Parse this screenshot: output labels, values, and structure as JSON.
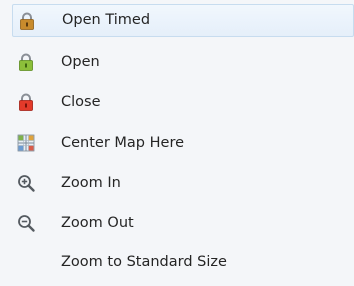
{
  "context_menu": {
    "items": [
      {
        "label": "Open Timed",
        "icon": "lock-timed-icon",
        "highlighted": true
      },
      {
        "label": "Open",
        "icon": "lock-open-green-icon"
      },
      {
        "label": "Close",
        "icon": "lock-closed-red-icon"
      },
      {
        "label": "Center Map Here",
        "icon": "center-map-grid-icon"
      },
      {
        "label": "Zoom In",
        "icon": "zoom-in-icon"
      },
      {
        "label": "Zoom Out",
        "icon": "zoom-out-icon"
      },
      {
        "label": "Zoom to Standard Size",
        "icon": ""
      }
    ],
    "colors": {
      "highlight_background": "#e8f1fb",
      "highlight_border": "#c7dcef",
      "menu_background": "#f4f6f9",
      "lock_timed_body": "#c88b2c",
      "lock_open_body": "#8cbf3a",
      "lock_closed_body": "#e33a2a",
      "text": "#252525"
    }
  }
}
